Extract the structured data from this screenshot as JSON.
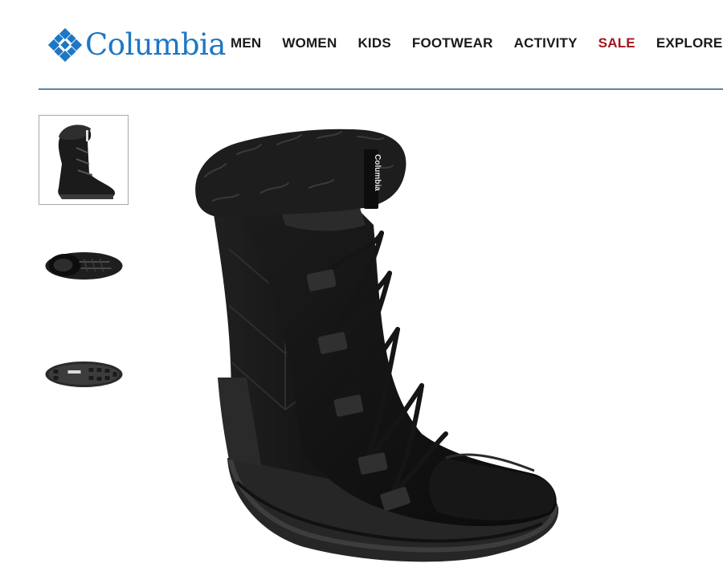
{
  "brand": {
    "name": "Columbia",
    "color": "#1e77c4"
  },
  "nav": {
    "items": [
      {
        "label": "MEN"
      },
      {
        "label": "WOMEN"
      },
      {
        "label": "KIDS"
      },
      {
        "label": "FOOTWEAR"
      },
      {
        "label": "ACTIVITY"
      },
      {
        "label": "SALE",
        "color": "#a0151d"
      },
      {
        "label": "EXPLORE CC"
      }
    ]
  },
  "gallery": {
    "thumbnails": [
      {
        "view": "side"
      },
      {
        "view": "top"
      },
      {
        "view": "sole"
      }
    ],
    "selected_index": 0,
    "boot_tag_text": "Columbia"
  }
}
